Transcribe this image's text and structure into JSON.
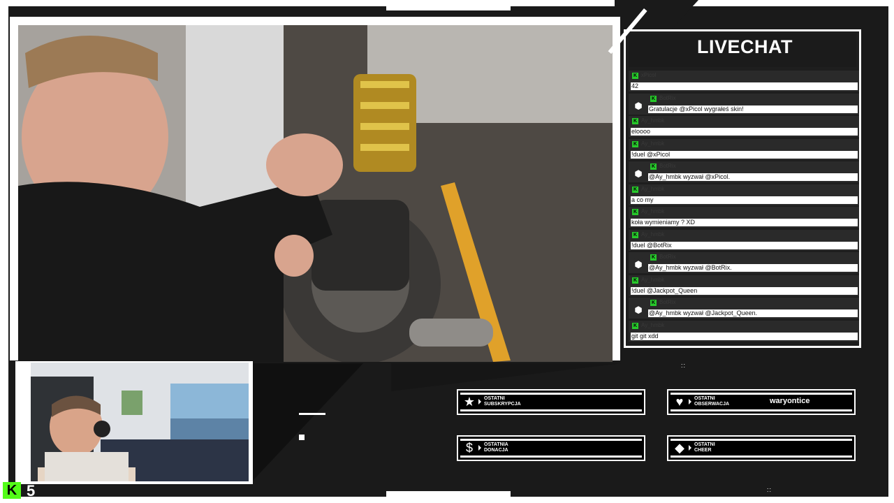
{
  "livechat": {
    "title": "LIVECHAT",
    "messages": [
      {
        "user": "xPicol",
        "text": "42",
        "bot": false
      },
      {
        "user": "BotRix",
        "text": "Gratulacje @xPicol wygrałeś skin!",
        "bot": true
      },
      {
        "user": "Ay_hmbk",
        "text": "eloooo",
        "bot": false
      },
      {
        "user": "Ay_hmbk",
        "text": "!duel @xPicol",
        "bot": false
      },
      {
        "user": "BotRix",
        "text": "@Ay_hmbk wyzwał @xPicol.",
        "bot": true
      },
      {
        "user": "Ay_hmbk",
        "text": "a co my",
        "bot": false
      },
      {
        "user": "Ay_hmbk",
        "text": "koła wymieniamy ? XD",
        "bot": false
      },
      {
        "user": "Ay_hmbk",
        "text": "!duel @BotRix",
        "bot": false
      },
      {
        "user": "BotRix",
        "text": "@Ay_hmbk wyzwał @BotRix.",
        "bot": true
      },
      {
        "user": "Ay_hmbk",
        "text": "!duel @Jackpot_Queen",
        "bot": false
      },
      {
        "user": "BotRix",
        "text": "@Ay_hmbk wyzwał @Jackpot_Queen.",
        "bot": true
      },
      {
        "user": "Ay_hmbk",
        "text": "git git xdd",
        "bot": false
      }
    ]
  },
  "alerts": {
    "subscription": {
      "label_line1": "OSTATNI",
      "label_line2": "SUBSKRYPCJA",
      "value": "",
      "icon": "star-icon"
    },
    "follow": {
      "label_line1": "OSTATNI",
      "label_line2": "OBSERWACJA",
      "value": "waryontice",
      "icon": "heart-icon"
    },
    "donation": {
      "label_line1": "OSTATNIA",
      "label_line2": "DONACJA",
      "value": "",
      "icon": "dollar-icon"
    },
    "cheer": {
      "label_line1": "OSTATNI",
      "label_line2": "CHEER",
      "value": "",
      "icon": "diamond-icon"
    }
  },
  "footer": {
    "logo": "K",
    "viewer_count": "5"
  },
  "colors": {
    "kick_green": "#53fc18",
    "badge_green": "#27c92b",
    "frame": "#ffffff",
    "panel": "#1e1e1e"
  }
}
